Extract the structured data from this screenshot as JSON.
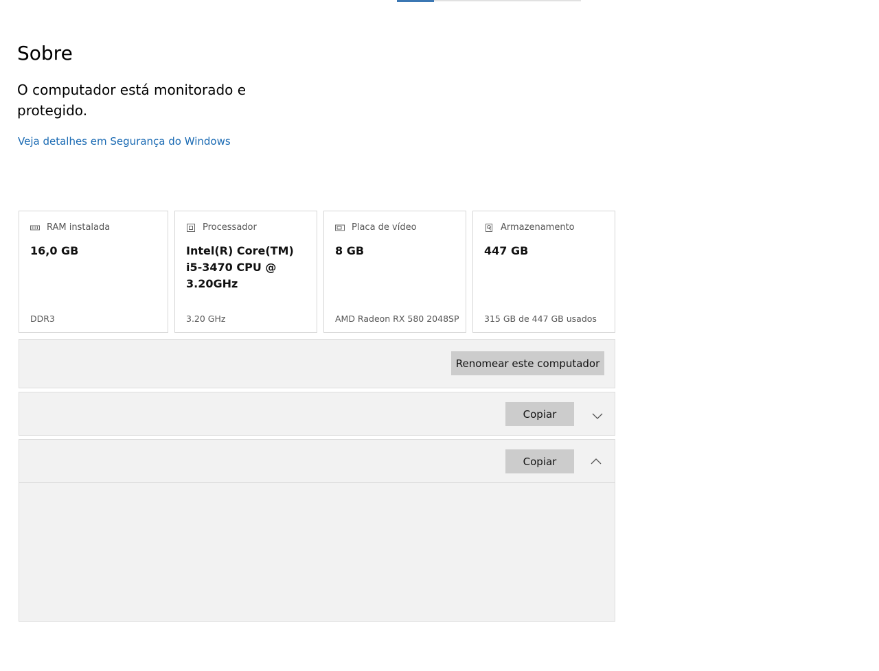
{
  "page": {
    "title": "Sobre",
    "status": "O computador está monitorado e protegido.",
    "security_link": "Veja detalhes em Segurança do Windows"
  },
  "specs": [
    {
      "icon": "ram-icon",
      "label": "RAM instalada",
      "value": "16,0 GB",
      "detail": "DDR3"
    },
    {
      "icon": "processor-icon",
      "label": "Processador",
      "value": "Intel(R) Core(TM) i5-3470 CPU @ 3.20GHz",
      "detail": "3.20 GHz"
    },
    {
      "icon": "gpu-icon",
      "label": "Placa de vídeo",
      "value": "8 GB",
      "detail": "AMD Radeon RX 580 2048SP"
    },
    {
      "icon": "storage-icon",
      "label": "Armazenamento",
      "value": "447 GB",
      "detail": "315 GB de 447 GB usados"
    }
  ],
  "rename": {
    "button_label": "Renomear este computador"
  },
  "device_specs": {
    "copy_label": "Copiar",
    "expanded": false
  },
  "windows_specs": {
    "copy_label": "Copiar",
    "expanded": true
  },
  "colors": {
    "link": "#1a6ab3",
    "accent": "#3b77b3",
    "panel_bg": "#f2f2f2",
    "button_bg": "#cccccc"
  }
}
